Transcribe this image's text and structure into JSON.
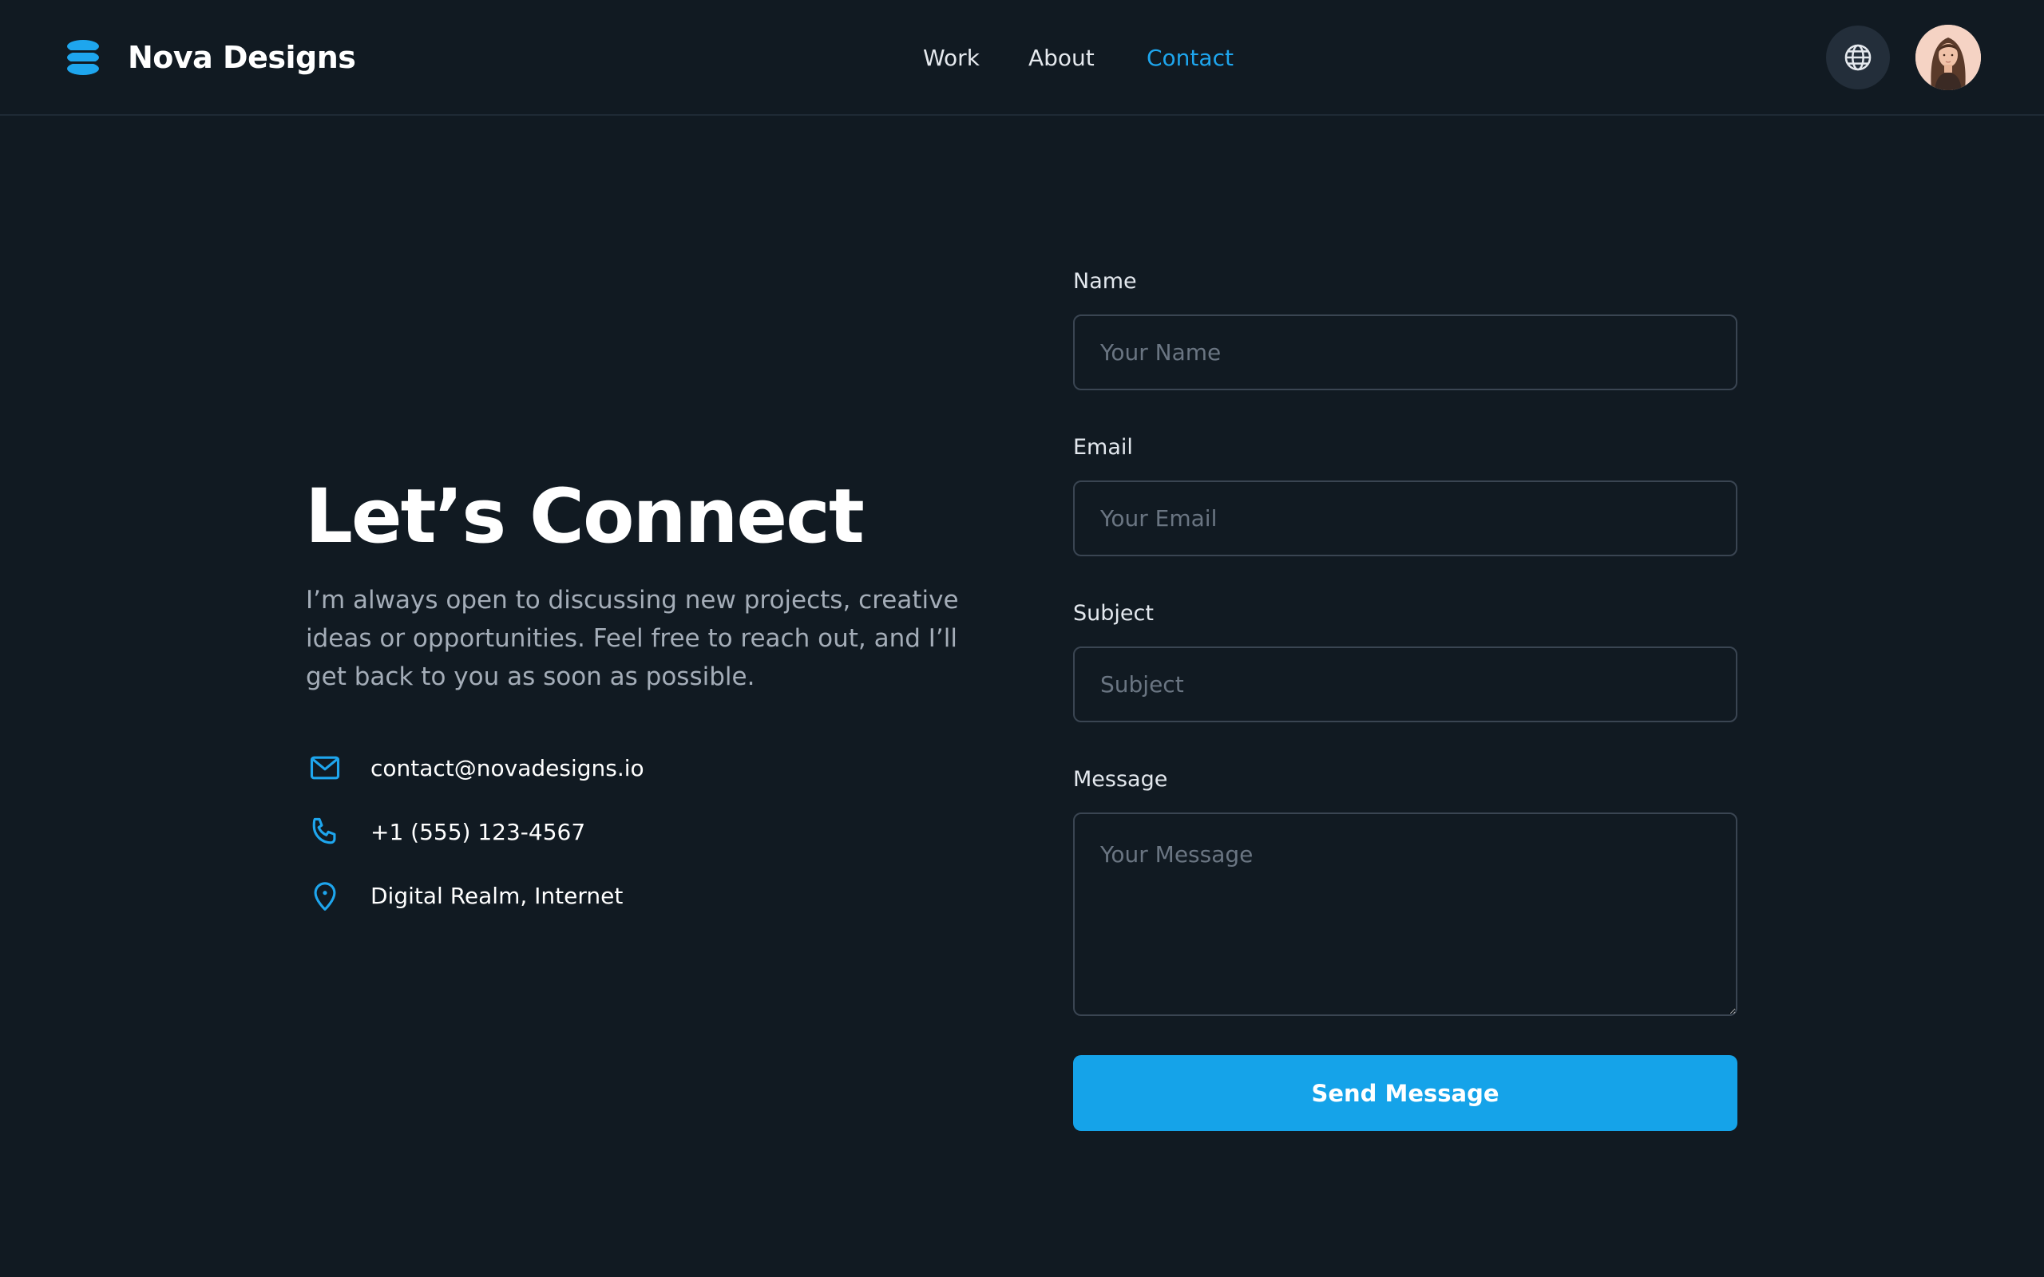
{
  "colors": {
    "background": "#111a22",
    "accent": "#15a3e9",
    "active_link": "#1ea6ee",
    "muted_text": "#a4adb8",
    "input_border": "#3a4552"
  },
  "header": {
    "logo_icon": "stacked-layers-icon",
    "brand_name": "Nova Designs",
    "nav": [
      {
        "label": "Work",
        "active": false
      },
      {
        "label": "About",
        "active": false
      },
      {
        "label": "Contact",
        "active": true
      }
    ],
    "language_icon": "globe-icon",
    "avatar_icon": "user-avatar"
  },
  "hero": {
    "title": "Let’s Connect",
    "description": "I’m always open to discussing new projects, creative ideas or opportunities. Feel free to reach out, and I’ll get back to you as soon as possible."
  },
  "contact_info": [
    {
      "icon": "mail-icon",
      "text": "contact@novadesigns.io"
    },
    {
      "icon": "phone-icon",
      "text": "+1 (555) 123-4567"
    },
    {
      "icon": "map-pin-icon",
      "text": "Digital Realm, Internet"
    }
  ],
  "form": {
    "name": {
      "label": "Name",
      "placeholder": "Your Name",
      "value": ""
    },
    "email": {
      "label": "Email",
      "placeholder": "Your Email",
      "value": ""
    },
    "subject": {
      "label": "Subject",
      "placeholder": "Subject",
      "value": ""
    },
    "message": {
      "label": "Message",
      "placeholder": "Your Message",
      "value": ""
    },
    "submit_label": "Send Message"
  }
}
